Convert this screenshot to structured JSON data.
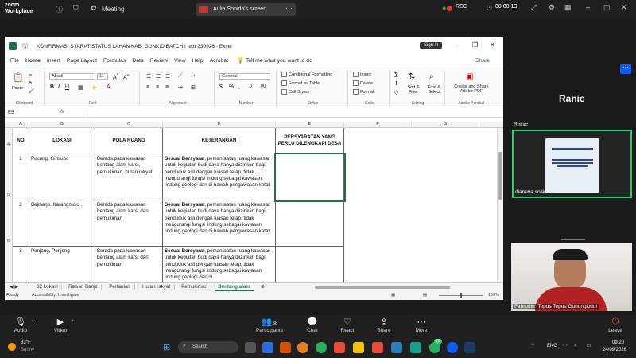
{
  "zoom": {
    "logo_line1": "zoom",
    "logo_line2": "Workplace",
    "meeting_label": "Meeting",
    "share_label": "Aulia Sonida's screen",
    "rec_label": "REC",
    "timer": "00:08:13",
    "controls": {
      "audio": "Audio",
      "video": "Video",
      "participants": "Participants",
      "participants_count": "38",
      "chat": "Chat",
      "react": "React",
      "share": "Share",
      "more": "More",
      "leave": "Leave"
    }
  },
  "excel": {
    "title": "KONFIRMASI SYARAT STATUS LAHAN KAB. GUNKID BATCH I_edt 230926 - Excel",
    "signin": "Sign in",
    "menu": [
      "File",
      "Home",
      "Insert",
      "Page Layout",
      "Formulas",
      "Data",
      "Review",
      "View",
      "Help",
      "Acrobat"
    ],
    "tell_me": "Tell me what you want to do",
    "share_btn": "Share",
    "ribbon": {
      "paste": "Paste",
      "clipboard": "Clipboard",
      "font_name": "Abadi",
      "font_size": "11",
      "font": "Font",
      "alignment": "Alignment",
      "number_format": "General",
      "number": "Number",
      "cond_format": "Conditional Formatting",
      "format_table": "Format as Table",
      "cell_styles": "Cell Styles",
      "styles": "Styles",
      "insert": "Insert",
      "delete": "Delete",
      "format": "Format",
      "cells": "Cells",
      "sort_filter": "Sort & Filter",
      "find_select": "Find & Select",
      "editing": "Editing",
      "create_share": "Create and Share Adobe PDF",
      "adobe": "Adobe Acrobat"
    },
    "name_box": "E5",
    "fx": "fx",
    "columns": [
      "A",
      "B",
      "C",
      "D",
      "E",
      "F",
      "G"
    ],
    "header_row_num": "4",
    "headers": {
      "no": "NO",
      "lokasi": "LOKASI",
      "pola": "POLA RUANG",
      "ket": "KETERANGAN",
      "syarat": "PERSYARATAN YANG PERLU DILENGKAPI DESA"
    },
    "rows": [
      {
        "rownum": "5",
        "no": "1",
        "lokasi": "Pucung, Girisubo",
        "pola": "Berada pada kawasan bentang alam karst, pemukiman, hutan rakyat",
        "ket_bold": "Sesuai Bersyarat",
        "ket": ", pemanfaatan ruang kawasan untuk kegiatan budi daya hanya diizinkan bagi penduduk asli dengan luasan tetap, tidak mengurangi fungsi lindung sebagai kawasan lindung geologi dan di bawah pengawasan ketat."
      },
      {
        "rownum": "6",
        "no": "2",
        "lokasi": "Bejiharjo, Karangmojo",
        "pola": "Berada pada kawasan bentang alam karst dan pemukiman",
        "ket_bold": "Sesuai Bersyarat",
        "ket": ", pemanfaatan ruang kawasan untuk kegiatan budi daya hanya diizinkan bagi penduduk asli dengan luasan tetap, tidak mengurangi fungsi lindung sebagai kawasan lindung geologi dan di bawah pengawasan ketat."
      },
      {
        "rownum": "7",
        "no": "3",
        "lokasi": "Ponjong, Ponjong",
        "pola": "Berada pada kawasan bentang alam karst dan pemukiman",
        "ket_bold": "Sesuai Bersyarat",
        "ket": ", pemanfaatan ruang kawasan untuk kegiatan budi daya hanya diizinkan bagi penduduk asli dengan luasan tetap, tidak mengurangi fungsi lindung sebagai kawasan lindung geologi dan di"
      }
    ],
    "sheets": [
      "32 Lokasi",
      "Rawan Banjir",
      "Pertanian",
      "Hutan rakyat",
      "Pemukiman",
      "Bentang alam"
    ],
    "active_sheet": "Bentang alam",
    "status_ready": "Ready",
    "accessibility": "Accessibility: Investigate",
    "zoom_level": "100%"
  },
  "panel": {
    "speaker_name": "Ranie",
    "tile1_label": "Ranie",
    "tile1_name": "dianeva solikha",
    "tile2_name": "Fahrudin_Tepus Tepus Gunungkidul"
  },
  "taskbar": {
    "temp": "83°F",
    "weather": "Sunny",
    "search": "Search",
    "lang": "ENG",
    "time": "09.20",
    "date": "24/09/2026",
    "badge": "29"
  },
  "colors": {
    "excel_green": "#217346",
    "rec_red": "#e23b3b",
    "tile_border": "#2ecc71",
    "zoom_blue": "#0b5cff"
  }
}
